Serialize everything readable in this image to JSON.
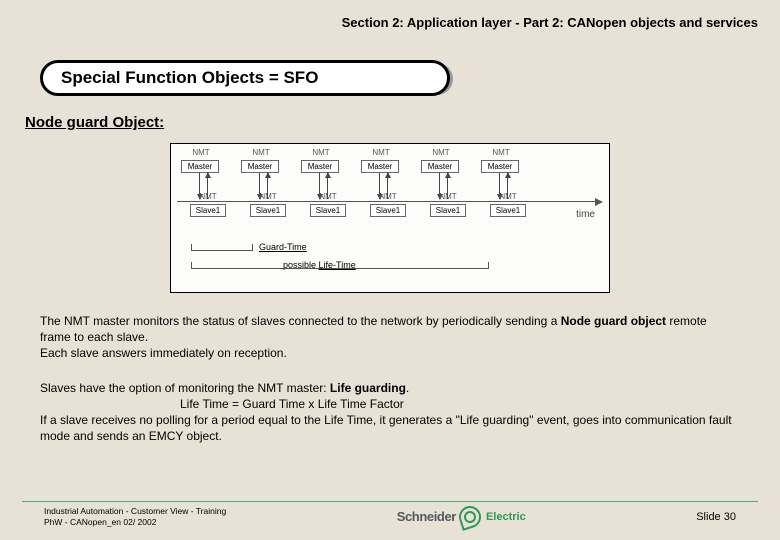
{
  "section_header": "Section 2: Application layer - Part 2: CANopen objects and services",
  "title": "Special Function Objects = SFO",
  "subhead": "Node guard Object:",
  "diagram": {
    "top_label": "NMT",
    "top_box": "Master",
    "bot_label": "NMT",
    "bot_box": "Slave1",
    "time_label": "time",
    "guard_label": "Guard-Time",
    "life_label_prefix": "possible ",
    "life_label_underline": "Life-Time",
    "pair_count": 6
  },
  "para1_a": "The NMT master monitors the status of slaves connected to the network by periodically sending a ",
  "para1_b": "Node guard object",
  "para1_c": " remote frame to each slave.",
  "para1_d": "Each slave answers immediately on reception.",
  "para2_a": "Slaves have the option of monitoring the NMT master: ",
  "para2_b": "Life guarding",
  "para2_c": ".",
  "para2_formula": "Life Time = Guard Time x Life Time Factor",
  "para2_d": "If a slave receives no polling for a period equal to the Life Time, it generates a \"Life guarding\" event, goes into communication fault mode and sends an EMCY object.",
  "footer_l1": "Industrial Automation - Customer View - Training",
  "footer_l2": "PhW - CANopen_en  02/ 2002",
  "logo_main": "Schneider",
  "logo_sub": "Electric",
  "slide_num": "Slide 30"
}
